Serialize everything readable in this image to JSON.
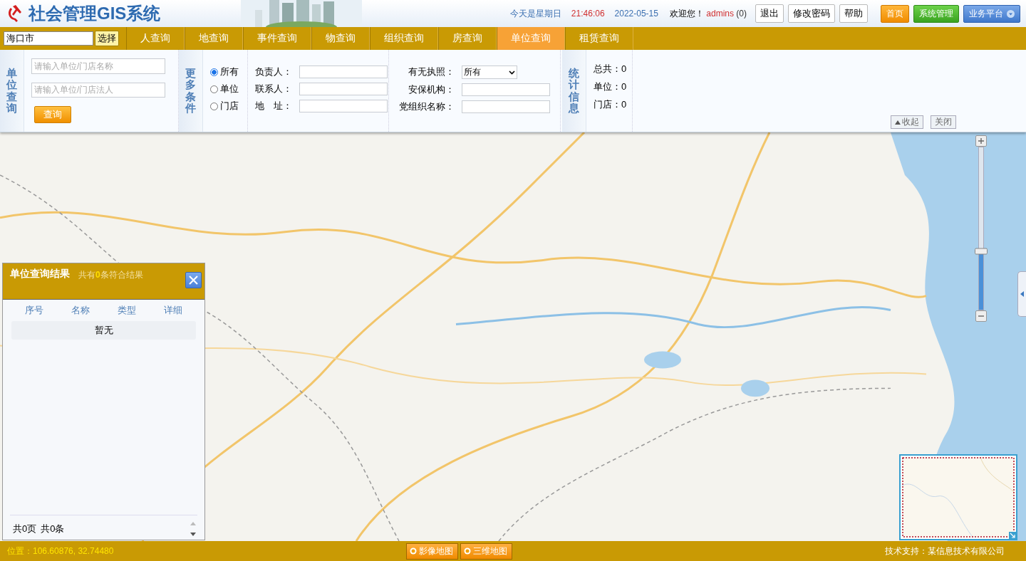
{
  "header": {
    "logo_text": "社会管理GIS系统",
    "weekday": "今天是星期日",
    "time": "21:46:06",
    "date": "2022-05-15",
    "welcome": "欢迎您！",
    "user": "admins",
    "user_count": "(0)",
    "links": [
      {
        "label": "退出"
      },
      {
        "label": "修改密码"
      },
      {
        "label": "帮助"
      }
    ],
    "nav_buttons": [
      {
        "label": "首页",
        "kind": "orange"
      },
      {
        "label": "系统管理",
        "kind": "green"
      },
      {
        "label": "业务平台",
        "kind": "blue"
      }
    ]
  },
  "city_picker": {
    "value": "海口市",
    "button": "选择"
  },
  "tabs": [
    {
      "label": "人查询",
      "selected": false
    },
    {
      "label": "地查询",
      "selected": false
    },
    {
      "label": "事件查询",
      "selected": false
    },
    {
      "label": "物查询",
      "selected": false
    },
    {
      "label": "组织查询",
      "selected": false
    },
    {
      "label": "房查询",
      "selected": false
    },
    {
      "label": "单位查询",
      "selected": true
    },
    {
      "label": "租赁查询",
      "selected": false
    }
  ],
  "query": {
    "title": "单位查询",
    "fields": [
      {
        "placeholder": "请输入单位/门店名称"
      },
      {
        "placeholder": "请输入单位/门店法人"
      }
    ],
    "button": "查询"
  },
  "more": {
    "title": "更多条件",
    "radios": [
      {
        "label": "所有",
        "selected": true
      },
      {
        "label": "单位",
        "selected": false
      },
      {
        "label": "门店",
        "selected": false
      }
    ],
    "fields_left": [
      {
        "label": "负责人：",
        "kind": "text"
      },
      {
        "label": "联系人：",
        "kind": "text"
      },
      {
        "label": "地　址：",
        "kind": "text"
      }
    ],
    "fields_right": [
      {
        "label": "有无执照：",
        "kind": "select",
        "value": "所有"
      },
      {
        "label": "安保机构：",
        "kind": "text"
      },
      {
        "label": "党组织名称：",
        "kind": "text"
      }
    ]
  },
  "stats": {
    "title": "统计信息",
    "items": [
      {
        "label": "总共：",
        "value": "0"
      },
      {
        "label": "单位：",
        "value": "0"
      },
      {
        "label": "门店：",
        "value": "0"
      }
    ],
    "actions": [
      {
        "label": "收起",
        "kind": "collapse"
      },
      {
        "label": "关闭",
        "kind": "close"
      }
    ]
  },
  "map": {
    "zoom": {
      "level": 0.36
    }
  },
  "results": {
    "title": "单位查询结果",
    "summary": "共有**0**条符合结果",
    "columns": [
      "序号",
      "名称",
      "类型",
      "详细"
    ],
    "empty": "暂无",
    "pages": "共0页",
    "count": "共0条"
  },
  "status_bar": {
    "position": "位置：106.60876, 32.74480",
    "map_modes": [
      {
        "label": "影像地图"
      },
      {
        "label": "三维地图"
      }
    ],
    "support": "技术支持：某信息技术有限公司"
  }
}
